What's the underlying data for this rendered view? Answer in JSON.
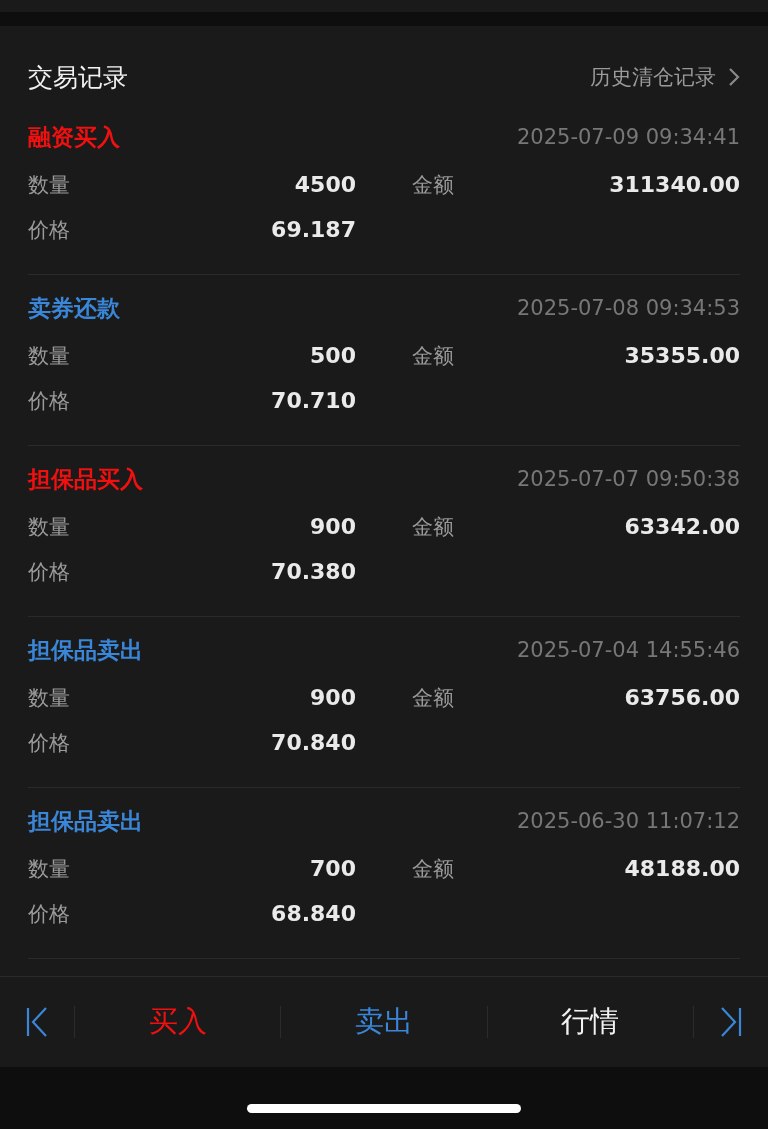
{
  "header": {
    "title": "交易记录",
    "link": "历史清仓记录"
  },
  "records": [
    {
      "type": "融资买入",
      "color": "#f01010",
      "time": "2025-07-09 09:34:41",
      "qty_label": "数量",
      "qty": "4500",
      "amount_label": "金额",
      "amount": "311340.00",
      "price_label": "价格",
      "price": "69.187"
    },
    {
      "type": "卖券还款",
      "color": "#3a86d8",
      "time": "2025-07-08 09:34:53",
      "qty_label": "数量",
      "qty": "500",
      "amount_label": "金额",
      "amount": "35355.00",
      "price_label": "价格",
      "price": "70.710"
    },
    {
      "type": "担保品买入",
      "color": "#f01010",
      "time": "2025-07-07 09:50:38",
      "qty_label": "数量",
      "qty": "900",
      "amount_label": "金额",
      "amount": "63342.00",
      "price_label": "价格",
      "price": "70.380"
    },
    {
      "type": "担保品卖出",
      "color": "#3a86d8",
      "time": "2025-07-04 14:55:46",
      "qty_label": "数量",
      "qty": "900",
      "amount_label": "金额",
      "amount": "63756.00",
      "price_label": "价格",
      "price": "70.840"
    },
    {
      "type": "担保品卖出",
      "color": "#3a86d8",
      "time": "2025-06-30 11:07:12",
      "qty_label": "数量",
      "qty": "700",
      "amount_label": "金额",
      "amount": "48188.00",
      "price_label": "价格",
      "price": "68.840"
    }
  ],
  "toolbar": [
    {
      "kind": "first"
    },
    {
      "kind": "buy",
      "label": "买入"
    },
    {
      "kind": "sell",
      "label": "卖出"
    },
    {
      "kind": "quote",
      "label": "行情"
    },
    {
      "kind": "last"
    }
  ]
}
